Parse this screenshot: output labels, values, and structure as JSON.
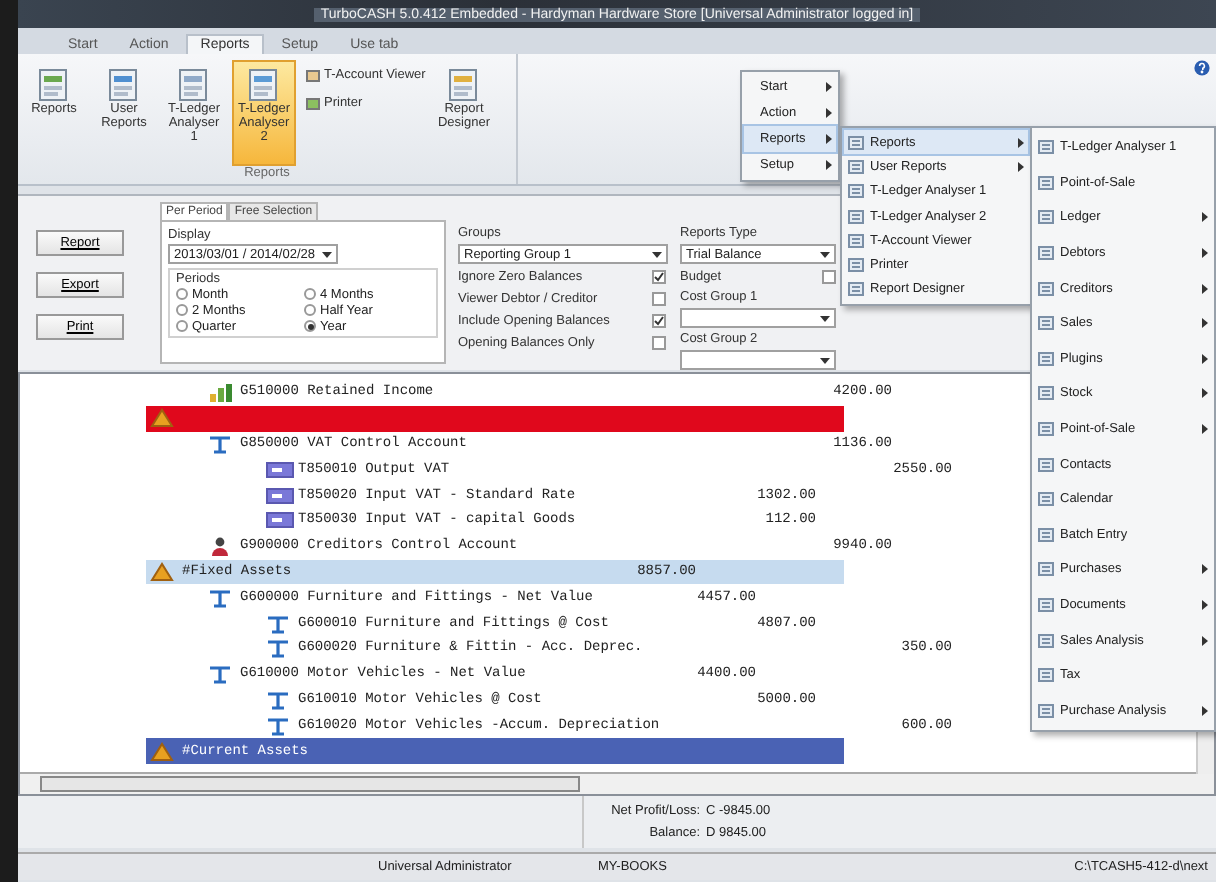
{
  "window": {
    "title": "TurboCASH 5.0.412 Embedded - Hardyman Hardware Store [Universal Administrator logged in]"
  },
  "menu_tabs": [
    {
      "label": "Start",
      "selected": false
    },
    {
      "label": "Action",
      "selected": false
    },
    {
      "label": "Reports",
      "selected": true
    },
    {
      "label": "Setup",
      "selected": false
    },
    {
      "label": "Use tab",
      "selected": false
    }
  ],
  "ribbon": {
    "group_label": "Reports",
    "buttons": [
      {
        "label": "Reports",
        "kind": "large",
        "selected": false
      },
      {
        "label": "User Reports",
        "kind": "large",
        "selected": false
      },
      {
        "label": "T-Ledger Analyser 1",
        "kind": "large",
        "selected": false
      },
      {
        "label": "T-Ledger Analyser 2",
        "kind": "large",
        "selected": true
      },
      {
        "label": "T-Account Viewer",
        "kind": "small",
        "selected": false
      },
      {
        "label": "Printer",
        "kind": "small",
        "selected": false
      },
      {
        "label": "Report Designer",
        "kind": "large",
        "selected": false
      }
    ]
  },
  "actions": [
    "Report",
    "Export",
    "Print"
  ],
  "period_tabs": [
    {
      "label": "Per Period",
      "selected": true
    },
    {
      "label": "Free Selection",
      "selected": false
    }
  ],
  "display": {
    "label": "Display",
    "value": "2013/03/01 / 2014/02/28"
  },
  "periods": {
    "label": "Periods",
    "options": [
      {
        "label": "Month",
        "selected": false
      },
      {
        "label": "4 Months",
        "selected": false
      },
      {
        "label": "2 Months",
        "selected": false
      },
      {
        "label": "Half Year",
        "selected": false
      },
      {
        "label": "Quarter",
        "selected": false
      },
      {
        "label": "Year",
        "selected": true
      }
    ]
  },
  "groups": {
    "label": "Groups",
    "value": "Reporting Group 1"
  },
  "options": [
    {
      "label": "Ignore Zero Balances",
      "checked": true
    },
    {
      "label": "Viewer Debtor / Creditor",
      "checked": false
    },
    {
      "label": "Include Opening Balances",
      "checked": true
    },
    {
      "label": "Opening Balances Only",
      "checked": false
    }
  ],
  "reports_type": {
    "label": "Reports Type",
    "value": "Trial Balance"
  },
  "budget": {
    "label": "Budget",
    "checked": false
  },
  "cost_groups": [
    {
      "label": "Cost Group 1"
    },
    {
      "label": "Cost Group 2"
    }
  ],
  "tree": {
    "continued": [
      {
        "label": "G510000 Retained Income",
        "credit": "4200.00",
        "kind": "income"
      }
    ],
    "items": [
      {
        "kind": "group",
        "color": "#e0081c",
        "children": [
          {
            "label": "G850000 VAT Control Account",
            "credit": "1136.00",
            "kind": "control",
            "children": [
              {
                "label": "T850010 Output VAT",
                "credit": "2550.00",
                "kind": "tax"
              },
              {
                "label": "T850020 Input VAT - Standard Rate",
                "debit": "1302.00",
                "kind": "tax"
              },
              {
                "label": "T850030 Input VAT - capital Goods",
                "debit": "112.00",
                "kind": "tax"
              }
            ]
          },
          {
            "label": "G900000 Creditors Control Account",
            "credit": "9940.00",
            "kind": "creditor"
          }
        ]
      },
      {
        "kind": "group",
        "color": "#c6dbef",
        "label": "#Fixed Assets",
        "debit": "8857.00",
        "children": [
          {
            "label": "G600000 Furniture and Fittings - Net Value",
            "debit": "4457.00",
            "kind": "control",
            "children": [
              {
                "label": "G600010 Furniture and Fittings @ Cost",
                "debit": "4807.00",
                "kind": "control"
              },
              {
                "label": "G600020 Furniture & Fittin - Acc. Deprec.",
                "credit": "350.00",
                "kind": "control"
              }
            ]
          },
          {
            "label": "G610000 Motor Vehicles - Net Value",
            "debit": "4400.00",
            "kind": "control",
            "children": [
              {
                "label": "G610010 Motor Vehicles @ Cost",
                "debit": "5000.00",
                "kind": "control"
              },
              {
                "label": "G610020 Motor Vehicles -Accum. Depreciation",
                "credit": "600.00",
                "kind": "control"
              }
            ]
          }
        ]
      },
      {
        "kind": "group",
        "color": "#4a62b4",
        "label": "#Current Assets"
      }
    ]
  },
  "totals": [
    {
      "label": "Net Profit/Loss:",
      "value": "C -9845.00"
    },
    {
      "label": "Balance:",
      "value": "D 9845.00"
    }
  ],
  "status_bar": [
    "Universal Administrator",
    "MY-BOOKS",
    "C:\\TCASH5-412-d\\next"
  ],
  "menus": [
    {
      "items": [
        {
          "label": "Start",
          "submenu": true,
          "selected": false
        },
        {
          "label": "Action",
          "submenu": true,
          "selected": false
        },
        {
          "label": "Reports",
          "submenu": true,
          "selected": true
        },
        {
          "label": "Setup",
          "submenu": true,
          "selected": false
        }
      ]
    },
    {
      "items": [
        {
          "label": "Reports",
          "submenu": true,
          "selected": true
        },
        {
          "label": "User Reports",
          "submenu": true,
          "selected": false
        },
        {
          "label": "T-Ledger Analyser 1",
          "submenu": false,
          "selected": false
        },
        {
          "label": "T-Ledger Analyser 2",
          "submenu": false,
          "selected": false
        },
        {
          "label": "T-Account Viewer",
          "submenu": false,
          "selected": false
        },
        {
          "label": "Printer",
          "submenu": false,
          "selected": false
        },
        {
          "label": "Report Designer",
          "submenu": false,
          "selected": false
        }
      ]
    },
    {
      "items": [
        {
          "label": "T-Ledger Analyser 1",
          "submenu": false,
          "selected": false
        },
        {
          "label": "Point-of-Sale",
          "submenu": false,
          "selected": false
        },
        {
          "label": "Ledger",
          "submenu": true,
          "selected": false
        },
        {
          "label": "Debtors",
          "submenu": true,
          "selected": false
        },
        {
          "label": "Creditors",
          "submenu": true,
          "selected": false
        },
        {
          "label": "Sales",
          "submenu": true,
          "selected": false
        },
        {
          "label": "Plugins",
          "submenu": true,
          "selected": false
        },
        {
          "label": "Stock",
          "submenu": true,
          "selected": false
        },
        {
          "label": "Point-of-Sale",
          "submenu": true,
          "selected": false
        },
        {
          "label": "Contacts",
          "submenu": false,
          "selected": false
        },
        {
          "label": "Calendar",
          "submenu": false,
          "selected": false
        },
        {
          "label": "Batch Entry",
          "submenu": false,
          "selected": false
        },
        {
          "label": "Purchases",
          "submenu": true,
          "selected": false
        },
        {
          "label": "Documents",
          "submenu": true,
          "selected": false
        },
        {
          "label": "Sales Analysis",
          "submenu": true,
          "selected": false
        },
        {
          "label": "Tax",
          "submenu": false,
          "selected": false
        },
        {
          "label": "Purchase Analysis",
          "submenu": true,
          "selected": false
        }
      ]
    }
  ]
}
